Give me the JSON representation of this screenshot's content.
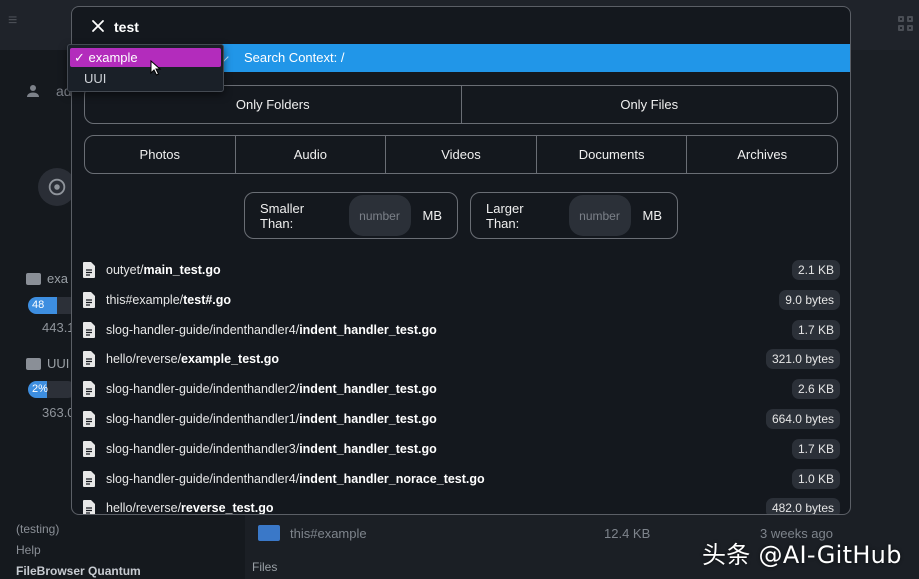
{
  "background": {
    "sidebar": {
      "user_label": "ad",
      "sources": [
        {
          "name": "exa",
          "usage_label": "48",
          "usage_percent": 48,
          "size": "443.1"
        },
        {
          "name": "UUI",
          "usage_label": "2%",
          "usage_percent": 2,
          "size": "363.0"
        }
      ],
      "footer": {
        "tag": "(testing)",
        "help": "Help",
        "app_name": "FileBrowser Quantum"
      }
    },
    "listing": {
      "row": {
        "name": "this#example",
        "size": "12.4 KB",
        "modified": "3 weeks ago"
      },
      "section_label": "Files"
    }
  },
  "watermark": "头条 @AI-GitHub",
  "search": {
    "query": "test",
    "context_label": "Search Context: /",
    "source_dropdown": {
      "options": [
        "example",
        "UUI"
      ],
      "selected": "example",
      "selected_display": "✓ example"
    },
    "type_filters": [
      "Only Folders",
      "Only Files"
    ],
    "category_filters": [
      "Photos",
      "Audio",
      "Videos",
      "Documents",
      "Archives"
    ],
    "size_filters": {
      "smaller_label": "Smaller Than:",
      "larger_label": "Larger Than:",
      "placeholder": "number",
      "unit": "MB"
    },
    "results": [
      {
        "dir": "outyet/",
        "name": "main_test.go",
        "size": "2.1 KB"
      },
      {
        "dir": "this#example/",
        "name": "test#.go",
        "size": "9.0 bytes"
      },
      {
        "dir": "slog-handler-guide/indenthandler4/",
        "name": "indent_handler_test.go",
        "size": "1.7 KB"
      },
      {
        "dir": "hello/reverse/",
        "name": "example_test.go",
        "size": "321.0 bytes"
      },
      {
        "dir": "slog-handler-guide/indenthandler2/",
        "name": "indent_handler_test.go",
        "size": "2.6 KB"
      },
      {
        "dir": "slog-handler-guide/indenthandler1/",
        "name": "indent_handler_test.go",
        "size": "664.0 bytes"
      },
      {
        "dir": "slog-handler-guide/indenthandler3/",
        "name": "indent_handler_test.go",
        "size": "1.7 KB"
      },
      {
        "dir": "slog-handler-guide/indenthandler4/",
        "name": "indent_handler_norace_test.go",
        "size": "1.0 KB"
      },
      {
        "dir": "hello/reverse/",
        "name": "reverse_test.go",
        "size": "482.0 bytes"
      }
    ]
  },
  "colors": {
    "context_bar": "#2196e8",
    "selected_option": "#b32cbc",
    "modal_bg": "#14181e"
  }
}
